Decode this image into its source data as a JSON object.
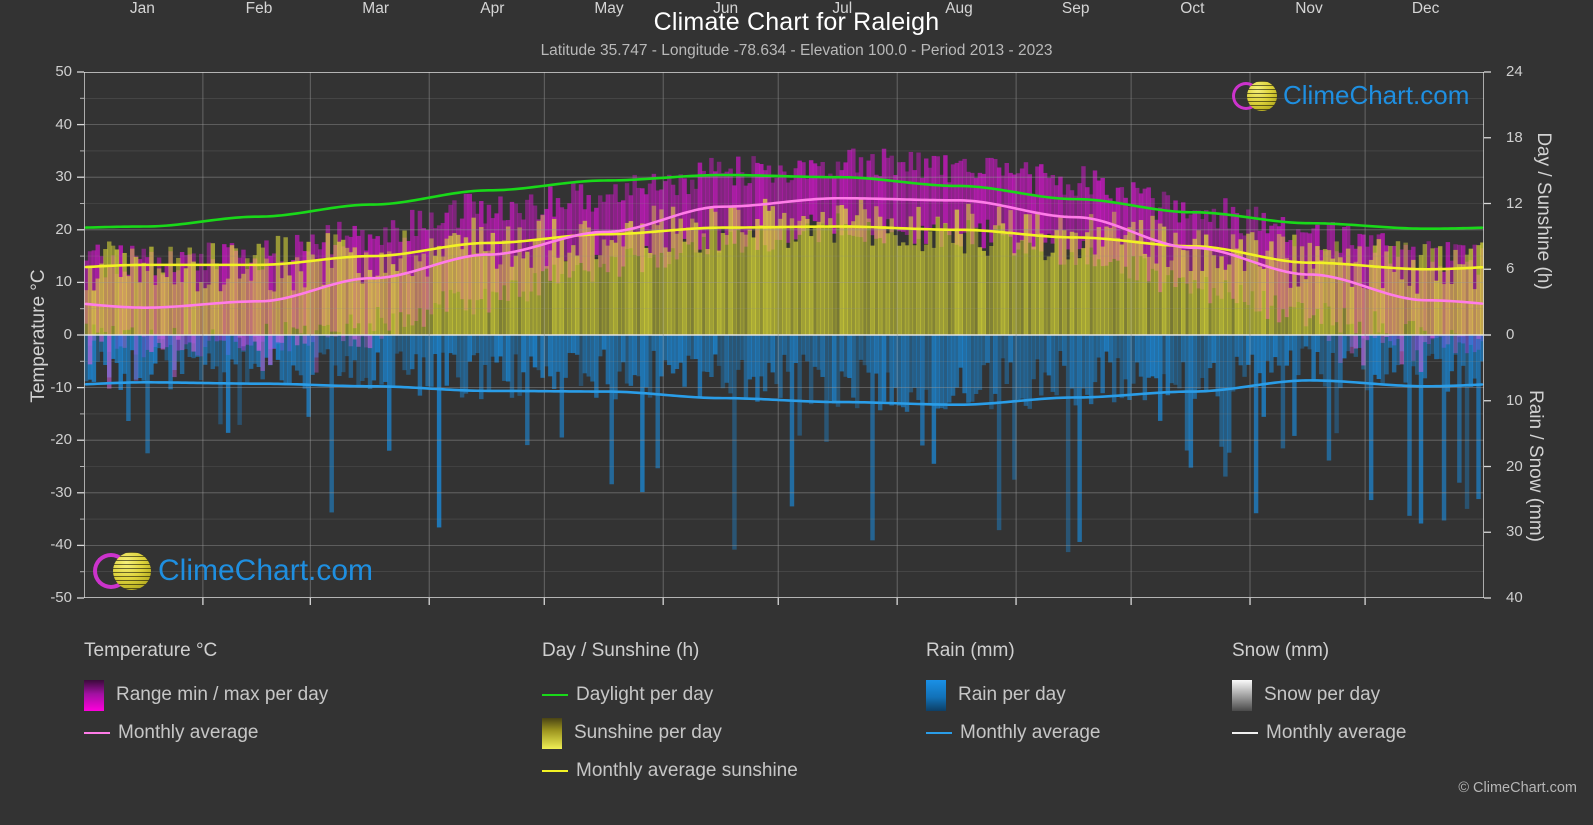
{
  "header": {
    "title": "Climate Chart for Raleigh",
    "subtitle": "Latitude 35.747 - Longitude -78.634 - Elevation 100.0 - Period 2013 - 2023"
  },
  "axes": {
    "left_title": "Temperature °C",
    "right_top_title": "Day / Sunshine (h)",
    "right_bottom_title": "Rain / Snow (mm)",
    "temp_ticks": [
      "50",
      "40",
      "30",
      "20",
      "10",
      "0",
      "-10",
      "-20",
      "-30",
      "-40",
      "-50"
    ],
    "sun_ticks": [
      "24",
      "18",
      "12",
      "6",
      "0"
    ],
    "rain_ticks": [
      "0",
      "10",
      "20",
      "30",
      "40"
    ],
    "months": [
      "Jan",
      "Feb",
      "Mar",
      "Apr",
      "May",
      "Jun",
      "Jul",
      "Aug",
      "Sep",
      "Oct",
      "Nov",
      "Dec"
    ]
  },
  "logo": {
    "text": "ClimeChart.com",
    "crescent_color": "#cc33cc",
    "globe_color": "#ded33c",
    "text_color": "#1f8fe0"
  },
  "legend": {
    "temperature": {
      "heading": "Temperature °C",
      "items": [
        {
          "label": "Range min / max per day",
          "swatch": "gradient",
          "color": "#ff00dd"
        },
        {
          "label": "Monthly average",
          "swatch": "line",
          "color": "#ff7ce8"
        }
      ]
    },
    "sunshine": {
      "heading": "Day / Sunshine (h)",
      "items": [
        {
          "label": "Daylight per day",
          "swatch": "line",
          "color": "#19d919"
        },
        {
          "label": "Sunshine per day",
          "swatch": "gradient",
          "color": "#e8e84a"
        },
        {
          "label": "Monthly average sunshine",
          "swatch": "line",
          "color": "#f2f224"
        }
      ]
    },
    "rain": {
      "heading": "Rain (mm)",
      "items": [
        {
          "label": "Rain per day",
          "swatch": "gradient",
          "color": "#1a8fe3"
        },
        {
          "label": "Monthly average",
          "swatch": "line",
          "color": "#2a9de8"
        }
      ]
    },
    "snow": {
      "heading": "Snow (mm)",
      "items": [
        {
          "label": "Snow per day",
          "swatch": "gradient",
          "color": "#e8e8e8"
        },
        {
          "label": "Monthly average",
          "swatch": "line",
          "color": "#f0f0f0"
        }
      ]
    }
  },
  "copyright": "© ClimeChart.com",
  "chart_data": {
    "type": "line",
    "title": "Climate Chart for Raleigh",
    "subtitle": "Latitude 35.747 - Longitude -78.634 - Elevation 100.0 - Period 2013 - 2023",
    "xlabel": "",
    "ylabel": "Temperature °C",
    "categories": [
      "Jan",
      "Feb",
      "Mar",
      "Apr",
      "May",
      "Jun",
      "Jul",
      "Aug",
      "Sep",
      "Oct",
      "Nov",
      "Dec"
    ],
    "ylim": [
      -50,
      50
    ],
    "y2lim_sunshine": [
      0,
      24
    ],
    "y2lim_rain": [
      0,
      40
    ],
    "grid": true,
    "legend_position": "below",
    "series": [
      {
        "name": "Monthly average temperature",
        "axis": "temperature",
        "unit": "°C",
        "color": "#ff7ce8",
        "values": [
          5.2,
          6.4,
          10.8,
          15.3,
          19.6,
          24.4,
          26.0,
          25.6,
          22.4,
          16.6,
          11.5,
          6.6
        ]
      },
      {
        "name": "Daylight per day",
        "axis": "sunshine",
        "unit": "h",
        "color": "#19d919",
        "values": [
          9.9,
          10.8,
          11.9,
          13.2,
          14.1,
          14.6,
          14.4,
          13.6,
          12.4,
          11.2,
          10.2,
          9.7
        ]
      },
      {
        "name": "Monthly average sunshine",
        "axis": "sunshine",
        "unit": "h",
        "color": "#f2f224",
        "values": [
          6.4,
          6.4,
          7.2,
          8.4,
          9.2,
          9.8,
          9.9,
          9.6,
          8.9,
          8.1,
          6.6,
          6.0
        ]
      },
      {
        "name": "Monthly average rain",
        "axis": "rain",
        "unit": "mm",
        "color": "#2a9de8",
        "values": [
          7.2,
          7.4,
          7.8,
          8.5,
          8.6,
          9.6,
          10.2,
          10.6,
          9.5,
          8.6,
          6.9,
          7.8
        ]
      },
      {
        "name": "Daily temperature range max",
        "axis": "temperature",
        "unit": "°C",
        "color": "#ff00dd",
        "values": [
          13.4,
          14.8,
          19.0,
          23.8,
          26.2,
          30.6,
          32.2,
          31.4,
          28.6,
          23.6,
          18.8,
          14.4
        ]
      },
      {
        "name": "Daily temperature range min",
        "axis": "temperature",
        "unit": "°C",
        "color": "#ff00dd",
        "values": [
          -1.2,
          -0.6,
          2.6,
          7.4,
          13.2,
          18.4,
          20.6,
          20.0,
          16.2,
          9.6,
          4.2,
          0.2
        ]
      }
    ]
  }
}
